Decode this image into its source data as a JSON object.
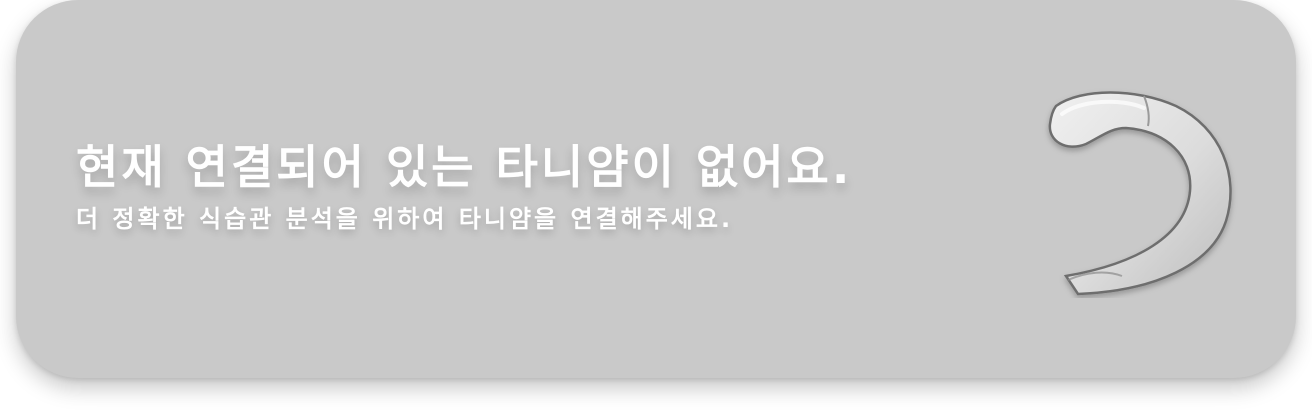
{
  "card": {
    "title": "현재 연결되어 있는 타니얌이 없어요.",
    "subtitle": "더 정확한 식습관 분석을 위하여 타니얌을 연결해주세요."
  },
  "device": {
    "icon": "earpiece-device-icon"
  },
  "colors": {
    "card_background": "#c9c9c9",
    "text": "#ffffff"
  }
}
